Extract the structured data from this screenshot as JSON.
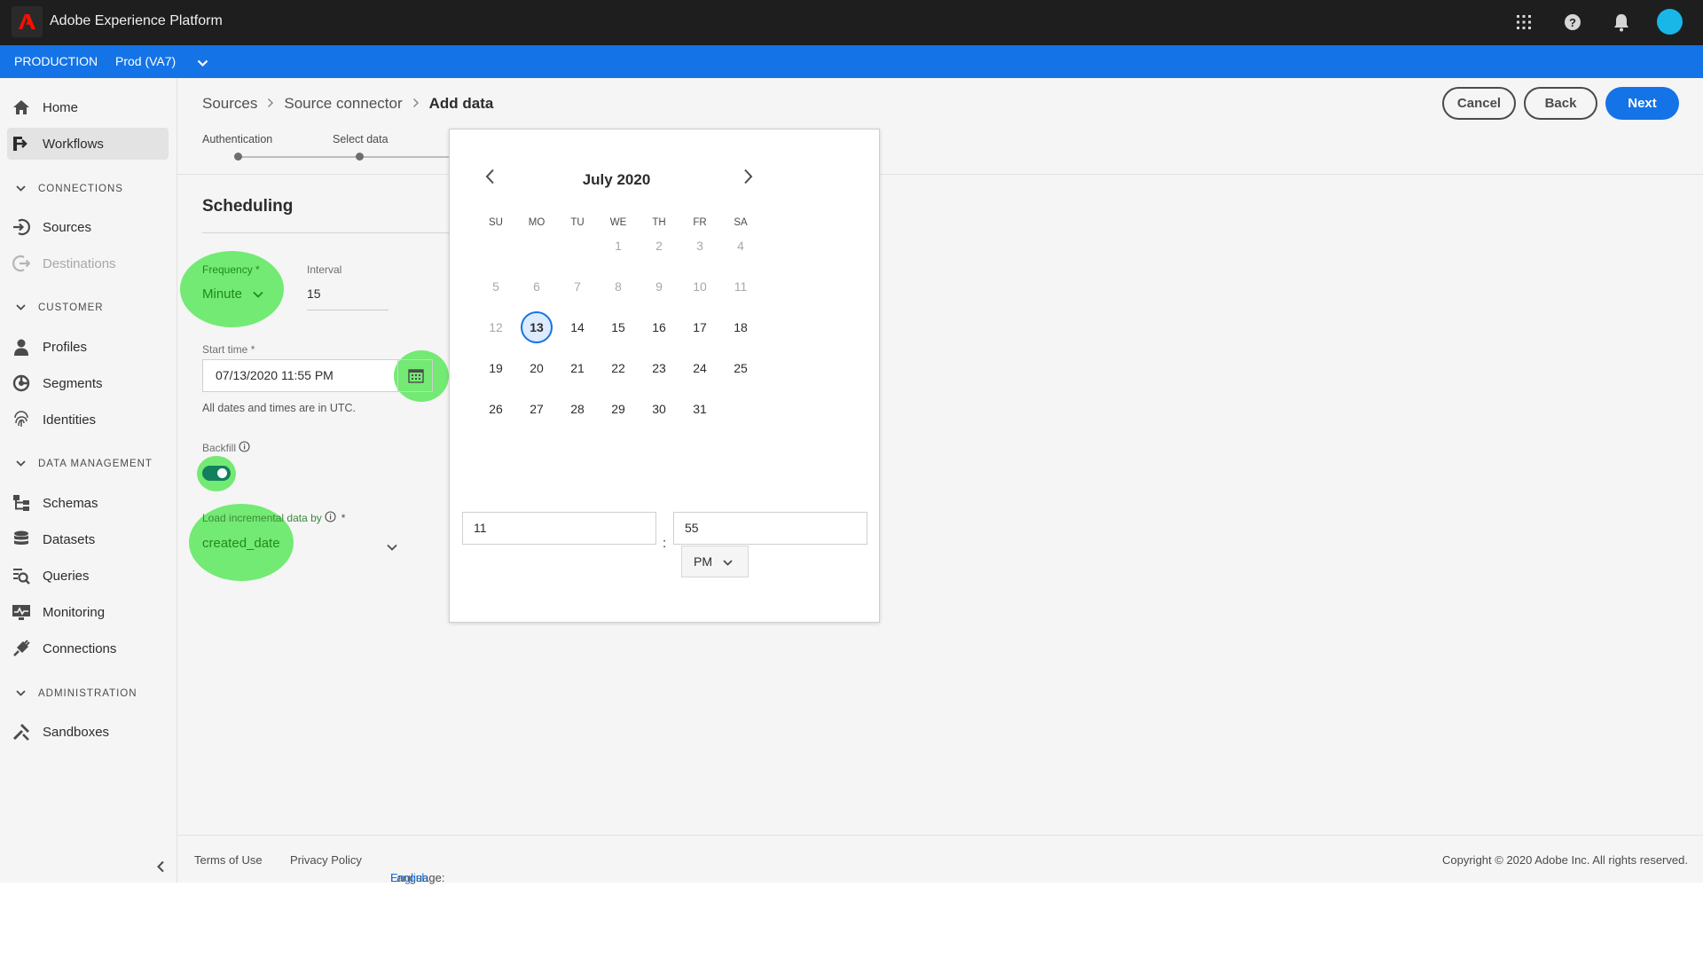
{
  "app": {
    "title": "Adobe Experience Platform"
  },
  "org": {
    "environment": "PRODUCTION",
    "sandbox": "Prod (VA7)"
  },
  "sidebar": {
    "home": "Home",
    "workflows": "Workflows",
    "sections": {
      "connections": "CONNECTIONS",
      "customer": "CUSTOMER",
      "data_management": "DATA MANAGEMENT",
      "administration": "ADMINISTRATION"
    },
    "items": {
      "sources": "Sources",
      "destinations": "Destinations",
      "profiles": "Profiles",
      "segments": "Segments",
      "identities": "Identities",
      "schemas": "Schemas",
      "datasets": "Datasets",
      "queries": "Queries",
      "monitoring": "Monitoring",
      "connections": "Connections",
      "sandboxes": "Sandboxes"
    }
  },
  "breadcrumb": {
    "first": "Sources",
    "second": "Source connector",
    "current": "Add data"
  },
  "actions": {
    "cancel": "Cancel",
    "back": "Back",
    "next": "Next"
  },
  "steps": {
    "authentication": "Authentication",
    "select_data": "Select data"
  },
  "scheduling": {
    "title": "Scheduling",
    "frequency_label": "Frequency",
    "frequency_value": "Minute",
    "interval_label": "Interval",
    "interval_value": "15",
    "start_time_label": "Start time",
    "start_time_value": "07/13/2020 11:55 PM",
    "utc_note": "All dates and times are in UTC.",
    "backfill_label": "Backfill",
    "backfill_on": true,
    "incremental_label": "Load incremental data by",
    "incremental_value": "created_date",
    "required_mark": "*"
  },
  "calendar": {
    "month_title": "July 2020",
    "weekdays": [
      "SU",
      "MO",
      "TU",
      "WE",
      "TH",
      "FR",
      "SA"
    ],
    "weeks": [
      [
        "",
        "",
        "1",
        "2",
        "3",
        "4"
      ],
      [
        "5",
        "6",
        "7",
        "8",
        "9",
        "10",
        "11"
      ],
      [
        "12",
        "13",
        "14",
        "15",
        "16",
        "17",
        "18"
      ],
      [
        "19",
        "20",
        "21",
        "22",
        "23",
        "24",
        "25"
      ],
      [
        "26",
        "27",
        "28",
        "29",
        "30",
        "31"
      ]
    ],
    "selected_day": "13",
    "hour": "11",
    "minute": "55",
    "separator": ":",
    "meridiem": "PM"
  },
  "footer": {
    "terms": "Terms of Use",
    "privacy": "Privacy Policy",
    "language_label": "Language:",
    "language_value": "English",
    "copyright": "Copyright ©  2020 Adobe Inc.  All rights reserved."
  },
  "colors": {
    "accent": "#1473e6",
    "topbar": "#1e1e1e",
    "highlight": "#5ce85c",
    "toggle_on": "#12805c"
  },
  "icons": [
    "adobe-logo-icon",
    "apps-grid-icon",
    "help-icon",
    "bell-icon",
    "calendar-icon",
    "chevron-left-icon",
    "chevron-right-icon",
    "chevron-down-icon",
    "info-icon"
  ]
}
